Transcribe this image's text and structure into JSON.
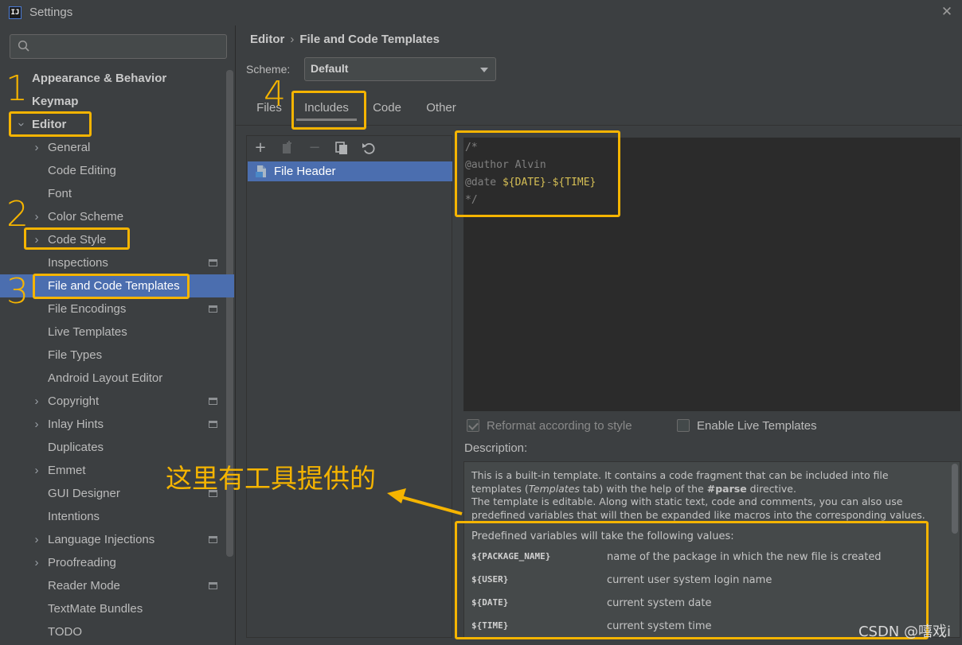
{
  "window": {
    "title": "Settings",
    "logo_text": "IJ"
  },
  "search": {
    "placeholder": "",
    "value": ""
  },
  "sidebar": {
    "items": [
      {
        "label": "Appearance & Behavior"
      },
      {
        "label": "Keymap"
      },
      {
        "label": "Editor",
        "expanded": true
      },
      {
        "label": "General"
      },
      {
        "label": "Code Editing"
      },
      {
        "label": "Font"
      },
      {
        "label": "Color Scheme"
      },
      {
        "label": "Code Style"
      },
      {
        "label": "Inspections"
      },
      {
        "label": "File and Code Templates",
        "selected": true
      },
      {
        "label": "File Encodings"
      },
      {
        "label": "Live Templates"
      },
      {
        "label": "File Types"
      },
      {
        "label": "Android Layout Editor"
      },
      {
        "label": "Copyright"
      },
      {
        "label": "Inlay Hints"
      },
      {
        "label": "Duplicates"
      },
      {
        "label": "Emmet"
      },
      {
        "label": "GUI Designer"
      },
      {
        "label": "Intentions"
      },
      {
        "label": "Language Injections"
      },
      {
        "label": "Proofreading"
      },
      {
        "label": "Reader Mode"
      },
      {
        "label": "TextMate Bundles"
      },
      {
        "label": "TODO"
      }
    ]
  },
  "breadcrumb": {
    "parent": "Editor",
    "separator": "›",
    "current": "File and Code Templates"
  },
  "scheme": {
    "label": "Scheme:",
    "value": "Default"
  },
  "tabs": [
    {
      "label": "Files"
    },
    {
      "label": "Includes",
      "active": true
    },
    {
      "label": "Code"
    },
    {
      "label": "Other"
    }
  ],
  "toolbar": {
    "add": "+",
    "remove": "−"
  },
  "template_list": {
    "items": [
      {
        "label": "File Header",
        "selected": true
      }
    ]
  },
  "editor": {
    "line1": "/*",
    "line2": "@author Alvin",
    "line3_prefix": "@date ",
    "date_var": "${DATE}",
    "dash": "-",
    "time_var": "${TIME}",
    "line4": "*/"
  },
  "options": {
    "reformat_label": "Reformat according to style",
    "reformat_checked": true,
    "live_templates_label": "Enable Live Templates",
    "live_templates_checked": false
  },
  "description": {
    "label": "Description:",
    "p1_a": "This is a built-in template. It contains a code fragment that can be included into file templates (",
    "p1_italic": "Templates",
    "p1_b": " tab) with the help of the ",
    "p1_bold": "#parse",
    "p1_c": " directive.",
    "p2": "The template is editable. Along with static text, code and comments, you can also use predefined variables that will then be expanded like macros into the corresponding values.",
    "predefined_title": "Predefined variables will take the following values:",
    "variables": [
      {
        "name": "${PACKAGE_NAME}",
        "desc": "name of the package in which the new file is created"
      },
      {
        "name": "${USER}",
        "desc": "current user system login name"
      },
      {
        "name": "${DATE}",
        "desc": "current system date"
      },
      {
        "name": "${TIME}",
        "desc": "current system time"
      }
    ]
  },
  "annotations": {
    "n1": "1",
    "n2": "2",
    "n3": "3",
    "n4": "4",
    "note": "这里有工具提供的",
    "color": "#f5b400"
  },
  "watermark": "CSDN @嘻戏i",
  "colors": {
    "selection": "#4b6eaf",
    "background": "#3c3f41",
    "editor_bg": "#2b2b2b",
    "highlight_var": "#d6bf55"
  }
}
